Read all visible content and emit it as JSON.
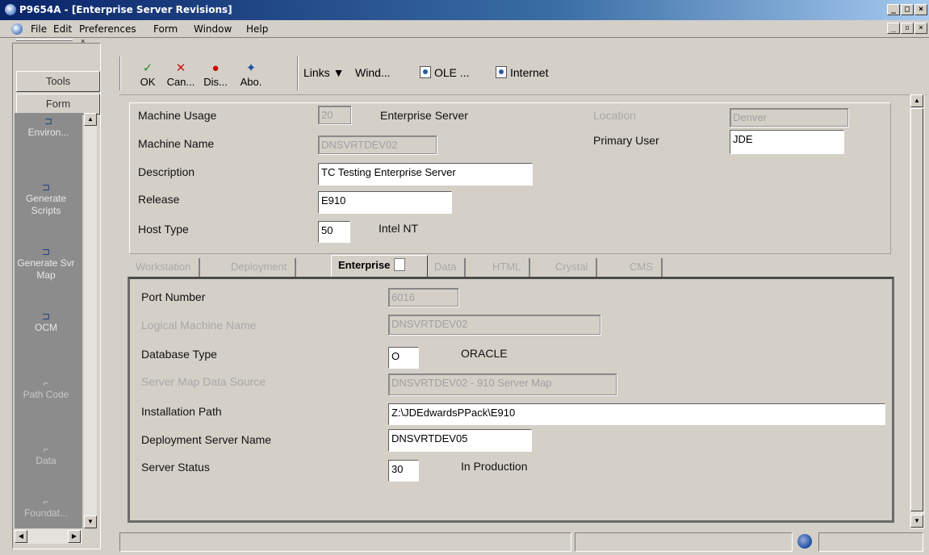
{
  "window": {
    "title": "P9654A - [Enterprise Server Revisions]"
  },
  "menubar": {
    "items": [
      "File",
      "Edit",
      "Preferences",
      "Form",
      "Window",
      "Help"
    ]
  },
  "left_pane": {
    "tools_label": "Tools",
    "form_label": "Form",
    "exits": [
      "Environ...",
      "Generate Scripts",
      "Generate Svr Map",
      "OCM",
      "Path Code",
      "Data",
      "Foundat..."
    ]
  },
  "toolbar": {
    "ok": "OK",
    "cancel": "Can...",
    "display": "Dis...",
    "about": "Abo.",
    "links": "Links",
    "window": "Wind...",
    "ole": "OLE ...",
    "internet": "Internet"
  },
  "header": {
    "machine_usage_label": "Machine Usage",
    "machine_usage_value": "20",
    "machine_usage_desc": "Enterprise Server",
    "location_label": "Location",
    "location_value": "Denver",
    "machine_name_label": "Machine Name",
    "machine_name_value": "DNSVRTDEV02",
    "primary_user_label": "Primary User",
    "primary_user_value": "JDE",
    "description_label": "Description",
    "description_value": "TC Testing Enterprise Server",
    "release_label": "Release",
    "release_value": "E910",
    "host_type_label": "Host Type",
    "host_type_value": "50",
    "host_type_desc": "Intel NT"
  },
  "tabs": [
    "Workstation",
    "Deployment",
    "Enterprise",
    "Data",
    "HTML",
    "Crystal",
    "CMS"
  ],
  "enterprise": {
    "port_number_label": "Port Number",
    "port_number_value": "6016",
    "logical_machine_label": "Logical Machine Name",
    "logical_machine_value": "DNSVRTDEV02",
    "db_type_label": "Database Type",
    "db_type_value": "O",
    "db_type_desc": "ORACLE",
    "server_map_label": "Server Map Data Source",
    "server_map_value": "DNSVRTDEV02 - 910 Server Map",
    "install_path_label": "Installation Path",
    "install_path_value": "Z:\\JDEdwardsPPack\\E910",
    "deploy_server_label": "Deployment Server Name",
    "deploy_server_value": "DNSVRTDEV05",
    "server_status_label": "Server Status",
    "server_status_value": "30",
    "server_status_desc": "In Production"
  },
  "colors": {
    "title_start": "#0a246a",
    "exit_bar": "#8c8c8c",
    "panel_face": "#d4d0c8"
  }
}
